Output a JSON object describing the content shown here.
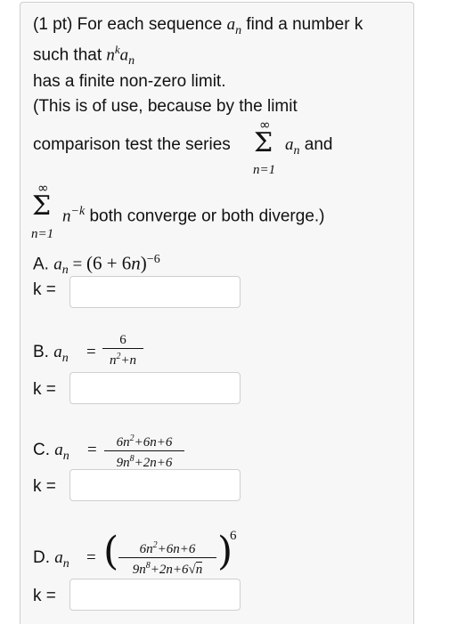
{
  "intro": {
    "line1_pre": "(1 pt) For each sequence ",
    "line1_var": "a",
    "line1_sub": "n",
    "line1_post": " find a number k",
    "line2_pre": "such that ",
    "line2_n": "n",
    "line2_k": "k",
    "line2_a": "a",
    "line2_sub": "n",
    "line3": "has a finite non-zero limit.",
    "line4": "(This is of use, because by the limit",
    "line5": "comparison test the series",
    "sum1_top": "∞",
    "sum1_bottom": "n=1",
    "sum_symbol": "Σ",
    "line5_a": "a",
    "line5_sub": "n",
    "line5_post": " and",
    "sum2_top": "∞",
    "sum2_bottom": "n=1",
    "line6_n": "n",
    "line6_exp": "−k",
    "line6_post": " both converge or both diverge.)"
  },
  "parts": {
    "a": {
      "label": "A. ",
      "var": "a",
      "sub": "n",
      "eq": " = ",
      "expr": "(6 + 6",
      "expr_n": "n",
      "expr_close": ")",
      "exp": "−6",
      "k_label": "k =",
      "k_value": ""
    },
    "b": {
      "label": "B. ",
      "var": "a",
      "sub": "n",
      "eq": "=",
      "num": "6",
      "den_a": "n",
      "den_a_exp": "2",
      "den_b": "+n",
      "k_label": "k =",
      "k_value": ""
    },
    "c": {
      "label": "C. ",
      "var": "a",
      "sub": "n",
      "eq": "=",
      "num_a": "6n",
      "num_a_exp": "2",
      "num_b": "+6n+6",
      "den_a": "9n",
      "den_a_exp": "8",
      "den_b": "+2n+6",
      "k_label": "k =",
      "k_value": ""
    },
    "d": {
      "label": "D. ",
      "var": "a",
      "sub": "n",
      "eq": "=",
      "num_a": "6n",
      "num_a_exp": "2",
      "num_b": "+6n+6",
      "den_a": "9n",
      "den_a_exp": "8",
      "den_b": "+2n+6",
      "den_root": "√",
      "den_root_arg": "n",
      "outer_exp": "6",
      "k_label": "k =",
      "k_value": ""
    }
  }
}
